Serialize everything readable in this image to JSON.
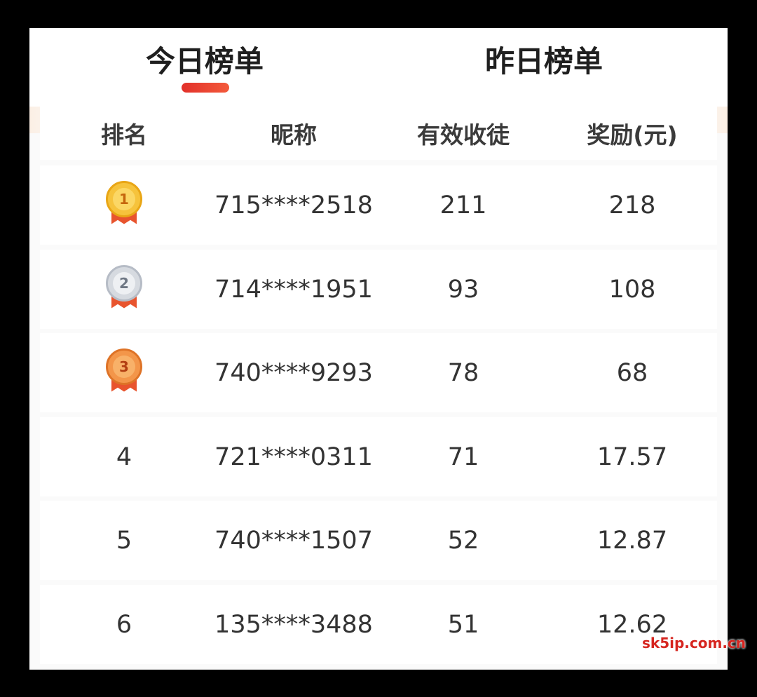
{
  "tabs": {
    "today": "今日榜单",
    "yesterday": "昨日榜单",
    "active": "today"
  },
  "table": {
    "headers": {
      "rank": "排名",
      "nickname": "昵称",
      "valid_invites": "有效收徒",
      "reward": "奖励(元)"
    },
    "rows": [
      {
        "rank": "1",
        "medal": "gold-medal-icon",
        "nickname": "715****2518",
        "valid_invites": "211",
        "reward": "218"
      },
      {
        "rank": "2",
        "medal": "silver-medal-icon",
        "nickname": "714****1951",
        "valid_invites": "93",
        "reward": "108"
      },
      {
        "rank": "3",
        "medal": "bronze-medal-icon",
        "nickname": "740****9293",
        "valid_invites": "78",
        "reward": "68"
      },
      {
        "rank": "4",
        "nickname": "721****0311",
        "valid_invites": "71",
        "reward": "17.57"
      },
      {
        "rank": "5",
        "nickname": "740****1507",
        "valid_invites": "52",
        "reward": "12.87"
      },
      {
        "rank": "6",
        "nickname": "135****3488",
        "valid_invites": "51",
        "reward": "12.62"
      }
    ]
  },
  "watermark": "sk5ip.com.cn",
  "colors": {
    "accent": "#e2302a",
    "gold": "#f6c33c",
    "silver": "#d6dae0",
    "bronze": "#f3964a"
  }
}
